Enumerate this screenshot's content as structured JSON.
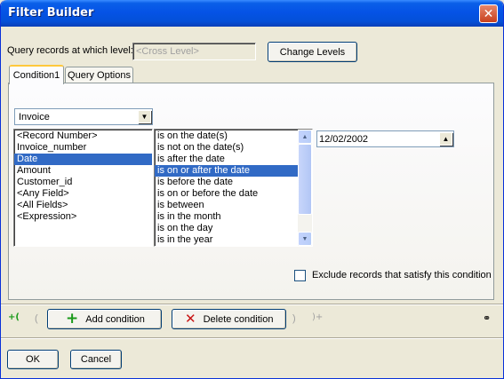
{
  "window": {
    "title": "Filter Builder"
  },
  "level": {
    "label": "Query records at which level:",
    "value": "<Cross Level>",
    "change_button": "Change Levels"
  },
  "tabs": [
    {
      "label": "Condition1"
    },
    {
      "label": "Query Options"
    }
  ],
  "condition": {
    "table_select": "Invoice",
    "fields": [
      "<Record Number>",
      "Invoice_number",
      "Date",
      "Amount",
      "Customer_id",
      "<Any Field>",
      "<All Fields>",
      "<Expression>"
    ],
    "selected_field_index": 2,
    "operators": [
      "is on the date(s)",
      "is not on the date(s)",
      "is after the date",
      "is on or after the date",
      "is before the date",
      "is on or before the date",
      "is between",
      "is in the month",
      "is on the day",
      "is in the year"
    ],
    "selected_operator_index": 3,
    "date_value": "12/02/2002",
    "exclude_label": "Exclude records that satisfy this condition"
  },
  "toolbar": {
    "open_paren": "(",
    "close_paren": ")",
    "add_condition": "Add condition",
    "delete_condition": "Delete condition"
  },
  "footer": {
    "ok": "OK",
    "cancel": "Cancel"
  },
  "icons": {
    "add": "plus-icon",
    "delete": "x-icon",
    "find": "binoculars-icon"
  },
  "colors": {
    "titlebar": "#0553e6",
    "selection": "#316ac5",
    "add_green": "#1a9a1a",
    "delete_red": "#c81414"
  }
}
